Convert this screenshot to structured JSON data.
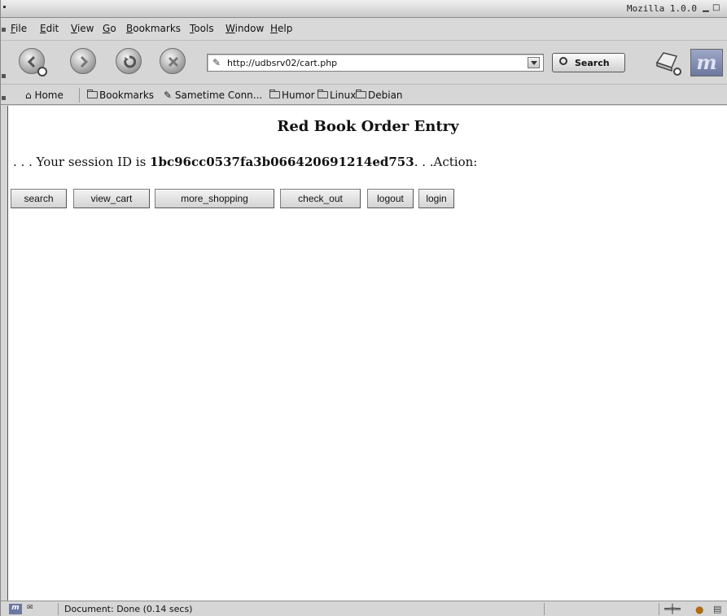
{
  "window": {
    "title": "Mozilla 1.0.0"
  },
  "menubar": {
    "items": [
      {
        "label": "File",
        "key": "F",
        "rest": "ile"
      },
      {
        "label": "Edit",
        "key": "E",
        "rest": "dit"
      },
      {
        "label": "View",
        "key": "V",
        "rest": "iew"
      },
      {
        "label": "Go",
        "key": "G",
        "rest": "o"
      },
      {
        "label": "Bookmarks",
        "key": "B",
        "rest": "ookmarks"
      },
      {
        "label": "Tools",
        "key": "T",
        "rest": "ools"
      },
      {
        "label": "Window",
        "key": "W",
        "rest": "indow"
      },
      {
        "label": "Help",
        "key": "H",
        "rest": "elp"
      }
    ]
  },
  "navbar": {
    "url": "http://udbsrv02/cart.php",
    "search_label": "Search"
  },
  "personal_toolbar": {
    "home": "Home",
    "bookmarks": "Bookmarks",
    "sametime": "Sametime Conn...",
    "humor": "Humor",
    "linux": "Linux",
    "debian": "Debian"
  },
  "page": {
    "heading": "Red Book Order Entry",
    "session_prefix": ". . . Your session ID is ",
    "session_id": "1bc96cc0537fa3b066420691214ed753",
    "session_suffix": ". . .Action:",
    "buttons": {
      "search": "search",
      "view_cart": "view_cart",
      "more_shopping": "more_shopping",
      "check_out": "check_out",
      "logout": "logout",
      "login": "login"
    }
  },
  "status": {
    "text": "Document: Done (0.14 secs)"
  },
  "colors": {
    "chrome": "#d6d6d6",
    "page_background": "#ffffff"
  }
}
